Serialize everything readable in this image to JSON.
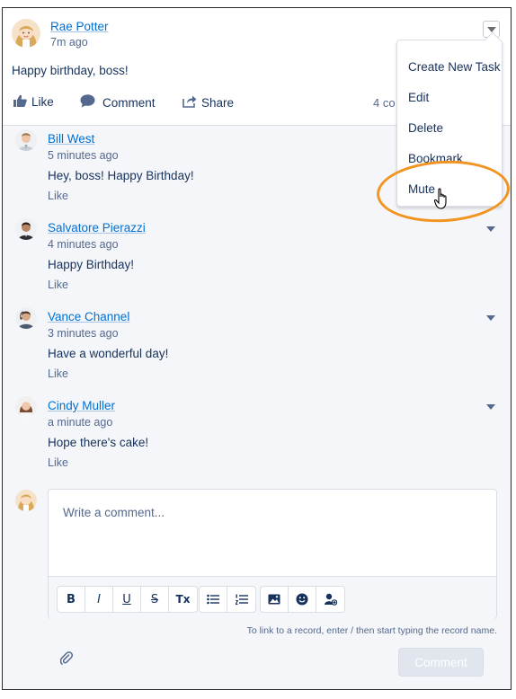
{
  "post": {
    "author": "Rae Potter",
    "time": "7m ago",
    "text": "Happy birthday, boss!",
    "actions": {
      "like": "Like",
      "comment": "Comment",
      "share": "Share"
    },
    "comment_count": "4 co"
  },
  "menu": {
    "items": [
      "Create New Task",
      "Edit",
      "Delete",
      "Bookmark",
      "Mute"
    ],
    "hovered": "Mute"
  },
  "comments": [
    {
      "author": "Bill West",
      "time": "5 minutes ago",
      "text": "Hey, boss! Happy Birthday!",
      "like": "Like"
    },
    {
      "author": "Salvatore Pierazzi",
      "time": "4 minutes ago",
      "text": "Happy Birthday!",
      "like": "Like"
    },
    {
      "author": "Vance Channel",
      "time": "3 minutes ago",
      "text": "Have a wonderful day!",
      "like": "Like"
    },
    {
      "author": "Cindy Muller",
      "time": "a minute ago",
      "text": "Hope there's cake!",
      "like": "Like"
    }
  ],
  "composer": {
    "placeholder": "Write a comment...",
    "toolbar": {
      "bold": "B",
      "italic": "I",
      "underline": "U",
      "strike": "S",
      "clear": "Tx",
      "bullets": "bulleted-list-icon",
      "numbers": "numbered-list-icon",
      "image": "image-icon",
      "emoji": "smiley-icon",
      "mention": "mention-user-icon"
    },
    "hint": "To link to a record, enter / then start typing the record name.",
    "submit": "Comment",
    "attach_icon": "paperclip-icon"
  },
  "colors": {
    "link": "#0070d2",
    "text": "#16325c",
    "muted": "#54698d",
    "feed_bg": "#f4f6f9",
    "highlight": "#f29421"
  }
}
